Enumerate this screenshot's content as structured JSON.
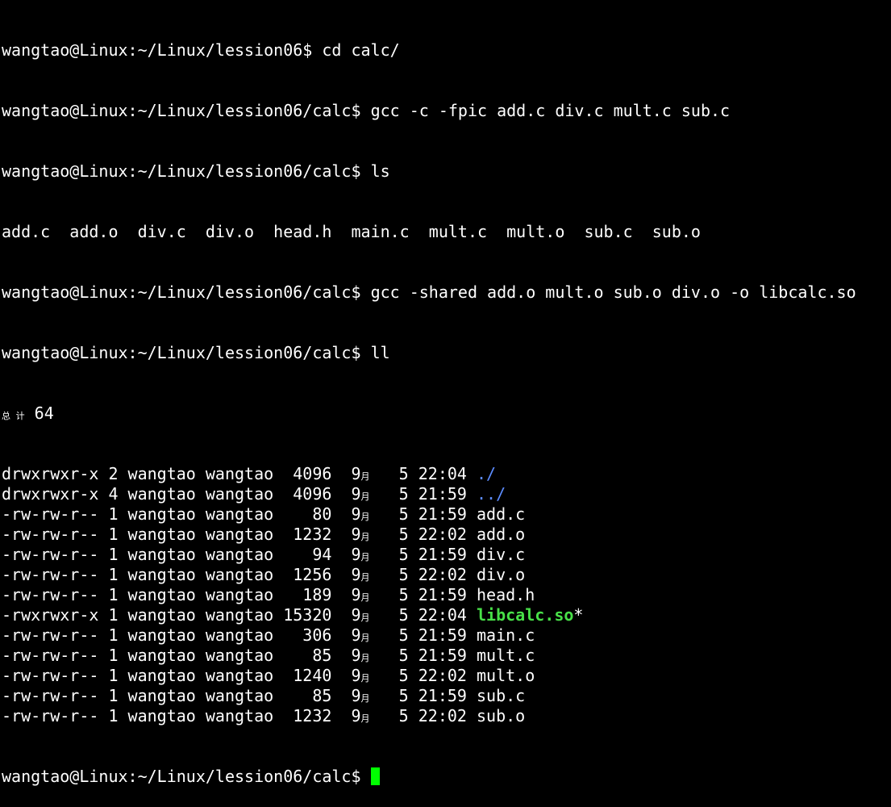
{
  "terminal": {
    "session": [
      {
        "prompt": "wangtao@Linux:~/Linux/lession06$ ",
        "command": "cd calc/"
      },
      {
        "prompt": "wangtao@Linux:~/Linux/lession06/calc$ ",
        "command": "gcc -c -fpic add.c div.c mult.c sub.c"
      },
      {
        "prompt": "wangtao@Linux:~/Linux/lession06/calc$ ",
        "command": "ls"
      }
    ],
    "ls_output": "add.c  add.o  div.c  div.o  head.h  main.c  mult.c  mult.o  sub.c  sub.o",
    "session2": [
      {
        "prompt": "wangtao@Linux:~/Linux/lession06/calc$ ",
        "command": "gcc -shared add.o mult.o sub.o div.o -o libcalc.so"
      },
      {
        "prompt": "wangtao@Linux:~/Linux/lession06/calc$ ",
        "command": "ll"
      }
    ],
    "total_label": "总 计",
    "total_value": " 64",
    "month_char": "月",
    "listing": [
      {
        "prefix": "drwxrwxr-x 2 wangtao wangtao  4096  9",
        "date": "   5 22:04 ",
        "name": "./",
        "type": "dir",
        "suffix": ""
      },
      {
        "prefix": "drwxrwxr-x 4 wangtao wangtao  4096  9",
        "date": "   5 21:59 ",
        "name": "../",
        "type": "dir",
        "suffix": ""
      },
      {
        "prefix": "-rw-rw-r-- 1 wangtao wangtao    80  9",
        "date": "   5 21:59 ",
        "name": "add.c",
        "type": "file",
        "suffix": ""
      },
      {
        "prefix": "-rw-rw-r-- 1 wangtao wangtao  1232  9",
        "date": "   5 22:02 ",
        "name": "add.o",
        "type": "file",
        "suffix": ""
      },
      {
        "prefix": "-rw-rw-r-- 1 wangtao wangtao    94  9",
        "date": "   5 21:59 ",
        "name": "div.c",
        "type": "file",
        "suffix": ""
      },
      {
        "prefix": "-rw-rw-r-- 1 wangtao wangtao  1256  9",
        "date": "   5 22:02 ",
        "name": "div.o",
        "type": "file",
        "suffix": ""
      },
      {
        "prefix": "-rw-rw-r-- 1 wangtao wangtao   189  9",
        "date": "   5 21:59 ",
        "name": "head.h",
        "type": "file",
        "suffix": ""
      },
      {
        "prefix": "-rwxrwxr-x 1 wangtao wangtao 15320  9",
        "date": "   5 22:04 ",
        "name": "libcalc.so",
        "type": "exec",
        "suffix": "*"
      },
      {
        "prefix": "-rw-rw-r-- 1 wangtao wangtao   306  9",
        "date": "   5 21:59 ",
        "name": "main.c",
        "type": "file",
        "suffix": ""
      },
      {
        "prefix": "-rw-rw-r-- 1 wangtao wangtao    85  9",
        "date": "   5 21:59 ",
        "name": "mult.c",
        "type": "file",
        "suffix": ""
      },
      {
        "prefix": "-rw-rw-r-- 1 wangtao wangtao  1240  9",
        "date": "   5 22:02 ",
        "name": "mult.o",
        "type": "file",
        "suffix": ""
      },
      {
        "prefix": "-rw-rw-r-- 1 wangtao wangtao    85  9",
        "date": "   5 21:59 ",
        "name": "sub.c",
        "type": "file",
        "suffix": ""
      },
      {
        "prefix": "-rw-rw-r-- 1 wangtao wangtao  1232  9",
        "date": "   5 22:02 ",
        "name": "sub.o",
        "type": "file",
        "suffix": ""
      }
    ],
    "final_prompt": "wangtao@Linux:~/Linux/lession06/calc$ ",
    "colors": {
      "background": "#000000",
      "text": "#ffffff",
      "directory": "#5c8cff",
      "executable": "#48e048",
      "cursor": "#00ff00"
    }
  }
}
